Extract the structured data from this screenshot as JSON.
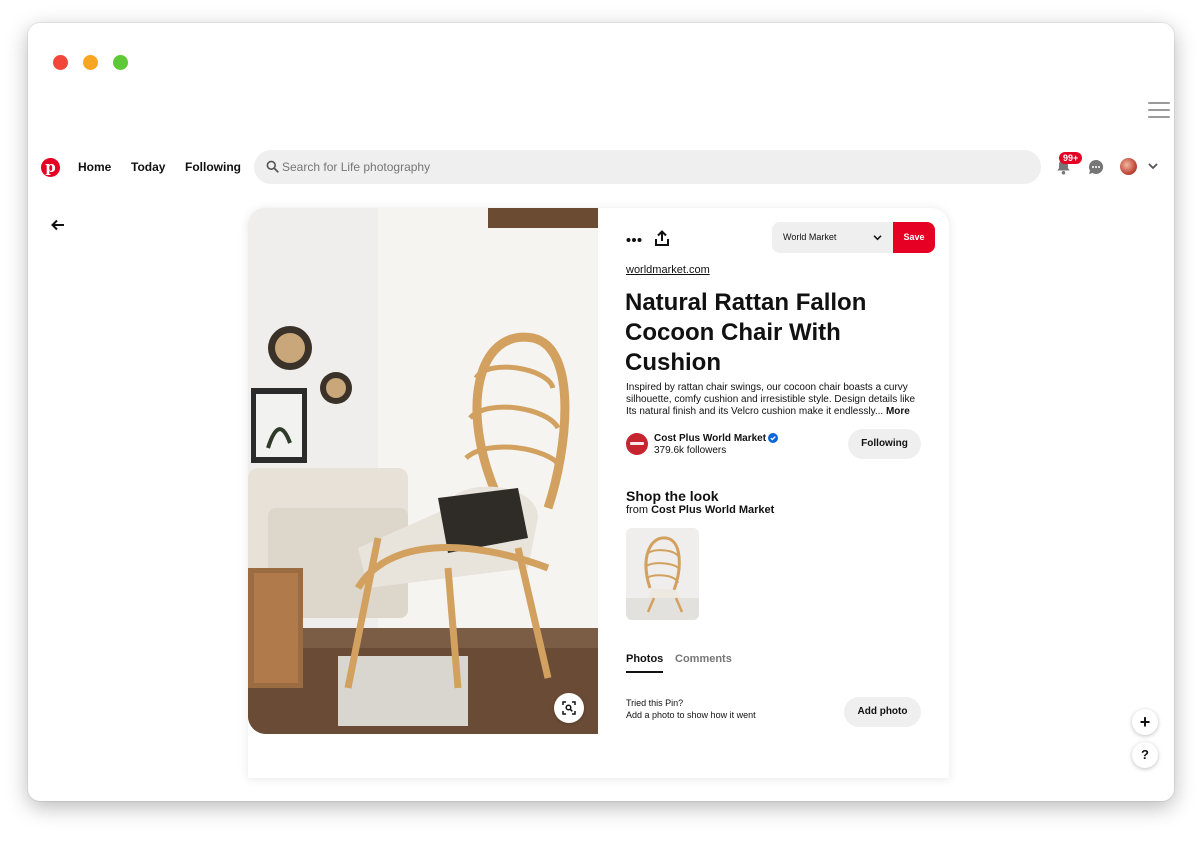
{
  "nav": {
    "home": "Home",
    "today": "Today",
    "following": "Following",
    "search_placeholder": "Search for Life photography",
    "notifications_badge": "99+"
  },
  "pin": {
    "board_select": "World Market",
    "save_label": "Save",
    "domain": "worldmarket.com",
    "title": "Natural Rattan Fallon Cocoon Chair With Cushion",
    "description": "Inspired by rattan chair swings, our cocoon chair boasts a curvy silhouette, comfy cushion and irresistible style. Design details like Its natural finish and its Velcro cushion make it endlessly...",
    "more_label": "More",
    "creator": {
      "name": "Cost Plus World Market",
      "followers": "379.6k followers",
      "following_button": "Following"
    },
    "shop": {
      "title": "Shop the look",
      "from_prefix": "from",
      "from_name": "Cost Plus World Market"
    },
    "tabs": [
      "Photos",
      "Comments"
    ],
    "tried": {
      "line1": "Tried this Pin?",
      "line2": "Add a photo to show how it went",
      "button": "Add photo"
    }
  },
  "fab": {
    "plus": "+",
    "help": "?"
  },
  "colors": {
    "brand_red": "#e60023",
    "button_grey": "#efefef",
    "verified_blue": "#0a66d6"
  },
  "icons": [
    "pinterest-logo",
    "search-icon",
    "bell-icon",
    "messages-icon",
    "chevron-down-icon",
    "back-arrow-icon",
    "more-dots-icon",
    "share-icon",
    "visual-search-icon",
    "verified-icon",
    "menu-icon"
  ]
}
